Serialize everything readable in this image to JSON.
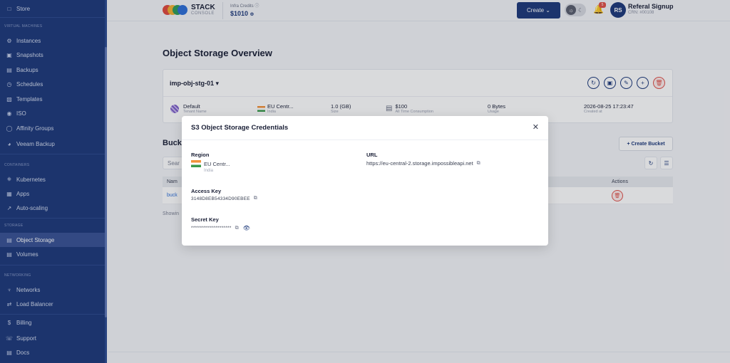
{
  "sidebar": {
    "top_item": {
      "label": "Store",
      "icon": "store-icon"
    },
    "sections": [
      {
        "title": "Virtual Machines"
      },
      {
        "title": "Containers"
      },
      {
        "title": "Storage"
      },
      {
        "title": "Networking"
      }
    ],
    "items": [
      {
        "label": "Instances",
        "icon": "instances-icon"
      },
      {
        "label": "Snapshots",
        "icon": "snapshots-icon"
      },
      {
        "label": "Backups",
        "icon": "backups-icon"
      },
      {
        "label": "Schedules",
        "icon": "schedules-icon"
      },
      {
        "label": "Templates",
        "icon": "templates-icon"
      },
      {
        "label": "ISO",
        "icon": "iso-icon"
      },
      {
        "label": "Affinity Groups",
        "icon": "affinity-icon"
      },
      {
        "label": "Veeam Backup",
        "icon": "veeam-icon"
      },
      {
        "label": "Kubernetes",
        "icon": "kubernetes-icon"
      },
      {
        "label": "Apps",
        "icon": "apps-icon"
      },
      {
        "label": "Auto-scaling",
        "icon": "autoscaling-icon"
      },
      {
        "label": "Object Storage",
        "icon": "object-storage-icon"
      },
      {
        "label": "Volumes",
        "icon": "volumes-icon"
      },
      {
        "label": "Networks",
        "icon": "networks-icon"
      },
      {
        "label": "Load Balancer",
        "icon": "load-balancer-icon"
      },
      {
        "label": "Billing",
        "icon": "billing-icon"
      },
      {
        "label": "Support",
        "icon": "support-icon"
      },
      {
        "label": "Docs",
        "icon": "docs-icon"
      }
    ]
  },
  "header": {
    "logo_main": "STACK",
    "logo_sub": "CONSOLE",
    "credits_label": "Infra Credits",
    "credits_value": "$1010",
    "create_label": "Create",
    "notification_count": "5",
    "avatar_initials": "RS",
    "account_name": "Referal Signup",
    "account_id": "CRN: #00108"
  },
  "main": {
    "title": "Object Storage Overview",
    "bucket_name": "imp-obj-stg-01",
    "stats": [
      {
        "value": "Default",
        "label": "Tenant Name"
      },
      {
        "value": "EU Centr...",
        "label": "India"
      },
      {
        "value": "1.0 (GB)",
        "label": "Size"
      },
      {
        "value": "$100",
        "label": "All Time Consumption"
      },
      {
        "value": "0 Bytes",
        "label": "Usage"
      },
      {
        "value": "2026-08-25 17:23:47",
        "label": "Created at"
      }
    ],
    "buckets_title": "Buck",
    "create_bucket_label": "+ Create Bucket",
    "search_placeholder": "Sear",
    "table_header_name": "Nam",
    "table_header_actions": "Actions",
    "row_link": "buck",
    "showing_text": "Showin"
  },
  "modal": {
    "title": "S3 Object Storage Credentials",
    "region_label": "Region",
    "region_value": "EU Centr...",
    "region_country": "India",
    "url_label": "URL",
    "url_value": "https://eu-central-2.storage.impossibleapi.net",
    "access_key_label": "Access Key",
    "access_key_value": "3148D8EB54334D90EBEE",
    "secret_key_label": "Secret Key",
    "secret_key_value": "********************"
  }
}
